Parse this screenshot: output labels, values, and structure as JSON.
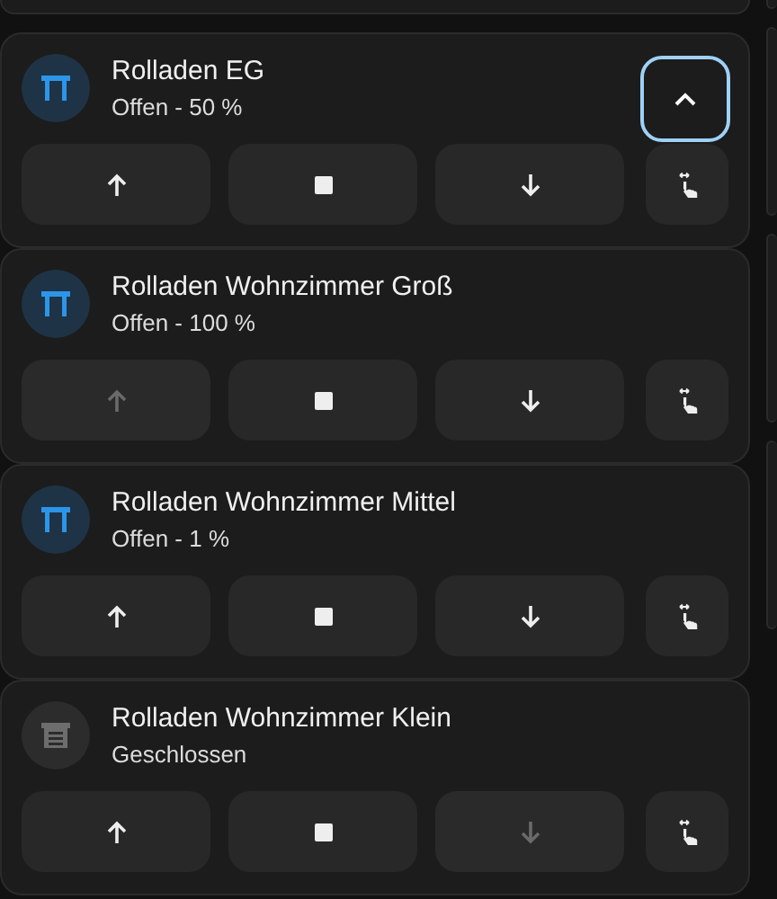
{
  "covers": [
    {
      "name": "Rolladen EG",
      "state": "Offen - 50 %",
      "kind": "open",
      "expand_button": {
        "focused": true
      },
      "buttons": [
        {
          "kind": "up",
          "disabled": false
        },
        {
          "kind": "stop",
          "disabled": false
        },
        {
          "kind": "down",
          "disabled": false
        },
        {
          "kind": "tilt",
          "disabled": false
        }
      ]
    },
    {
      "name": "Rolladen Wohnzimmer Groß",
      "state": "Offen - 100 %",
      "kind": "open",
      "buttons": [
        {
          "kind": "up",
          "disabled": true
        },
        {
          "kind": "stop",
          "disabled": false
        },
        {
          "kind": "down",
          "disabled": false
        },
        {
          "kind": "tilt",
          "disabled": false
        }
      ]
    },
    {
      "name": "Rolladen Wohnzimmer Mittel",
      "state": "Offen - 1 %",
      "kind": "open",
      "buttons": [
        {
          "kind": "up",
          "disabled": false
        },
        {
          "kind": "stop",
          "disabled": false
        },
        {
          "kind": "down",
          "disabled": false
        },
        {
          "kind": "tilt",
          "disabled": false
        }
      ]
    },
    {
      "name": "Rolladen Wohnzimmer Klein",
      "state": "Geschlossen",
      "kind": "closed",
      "buttons": [
        {
          "kind": "up",
          "disabled": false
        },
        {
          "kind": "stop",
          "disabled": false
        },
        {
          "kind": "down",
          "disabled": true
        },
        {
          "kind": "tilt",
          "disabled": false
        }
      ]
    }
  ]
}
